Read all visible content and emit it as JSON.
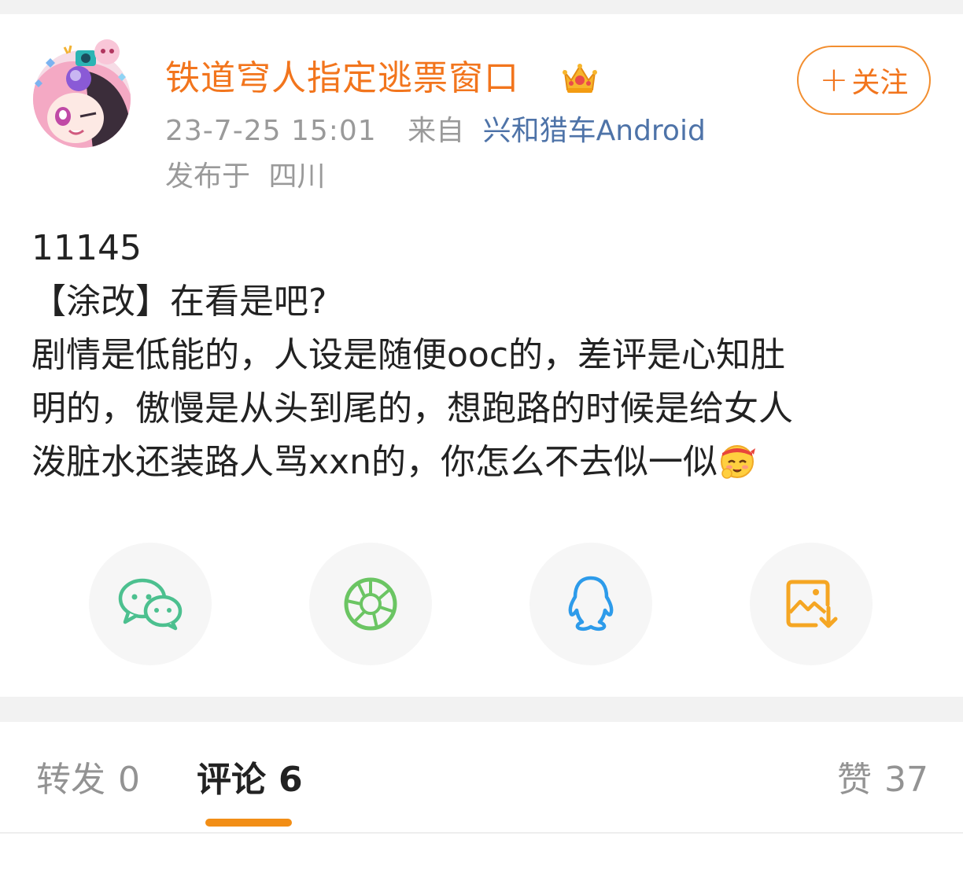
{
  "post": {
    "author": {
      "name": "铁道穹人指定逃票窗口",
      "badge_icon": "crown-icon",
      "avatar_icon": "anime-avatar"
    },
    "follow_button": {
      "plus": "+",
      "label": "关注"
    },
    "time": "23-7-25 15:01",
    "source_prefix": "来自",
    "source": "兴和猎车Android",
    "location_prefix": "发布于",
    "location": "四川",
    "content": {
      "line1": "11145",
      "line2": "【涂改】在看是吧?",
      "line3": "剧情是低能的，人设是随便ooc的，差评是心知肚",
      "line4": "明的，傲慢是从头到尾的，想跑路的时候是给女人",
      "line5": "泼脏水还装路人骂xxn的，你怎么不去似一似",
      "trailing_emoji": "cheer-emoji"
    }
  },
  "share": {
    "items": [
      {
        "icon": "wechat-icon"
      },
      {
        "icon": "moments-icon"
      },
      {
        "icon": "qq-icon"
      },
      {
        "icon": "save-image-icon"
      }
    ],
    "colors": {
      "wechat": "#4cc08f",
      "moments": "#6bc563",
      "qq": "#2d9bea",
      "save": "#f5a623"
    }
  },
  "tabs": {
    "repost_label": "转发",
    "repost_count": "0",
    "comment_label": "评论",
    "comment_count": "6",
    "like_label": "赞",
    "like_count": "37"
  },
  "colors": {
    "accent": "#f2751d",
    "link": "#4e73a8",
    "indicator": "#f28e16"
  }
}
